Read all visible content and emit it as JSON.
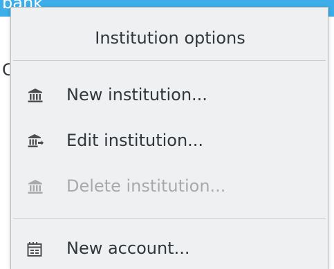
{
  "background": {
    "top_row_text": "bank",
    "partial_row_text": "C",
    "highlight_color": "#3daee9"
  },
  "menu": {
    "title": "Institution options",
    "items": [
      {
        "label": "New institution...",
        "icon": "bank-icon",
        "enabled": true
      },
      {
        "label": "Edit institution...",
        "icon": "bank-edit-icon",
        "enabled": true
      },
      {
        "label": "Delete institution...",
        "icon": "bank-delete-icon",
        "enabled": false
      },
      {
        "label": "New account...",
        "icon": "new-account-icon",
        "enabled": true
      }
    ]
  },
  "colors": {
    "menu_bg": "#eff0f1",
    "text": "#31363b",
    "disabled_text": "#a7aaad"
  }
}
